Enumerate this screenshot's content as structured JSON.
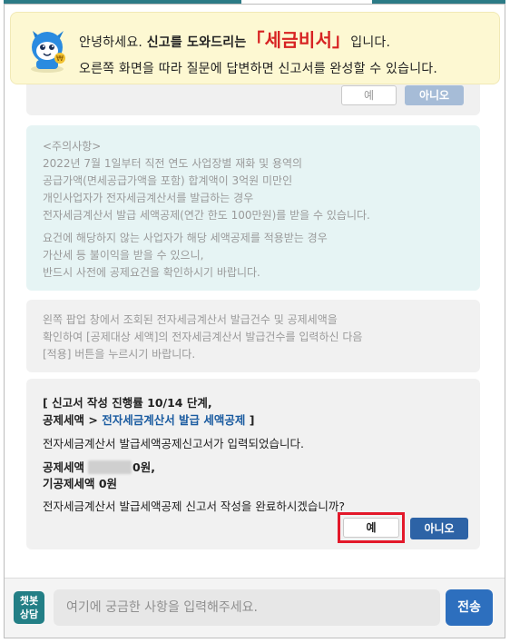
{
  "banner": {
    "greeting": "안녕하세요.",
    "intro_strong": "신고를 도와드리는",
    "bracket_open": "「",
    "brand": "세금비서",
    "bracket_close": "」",
    "suffix": "입니다.",
    "line2": "오른쪽 화면을 따라 질문에 답변하면 신고서를 완성할 수 있습니다."
  },
  "prev_card": {
    "yes_label": "예",
    "no_label": "아니오"
  },
  "notice": {
    "title": "<주의사항>",
    "lines": [
      "2022년 7월 1일부터 직전 연도 사업장별 재화 및 용역의",
      "공급가액(면세공급가액을 포함) 합계액이 3억원 미만인",
      "개인사업자가 전자세금계산서를 발급하는 경우",
      "전자세금계산서 발급 세액공제(연간 한도 100만원)를 받을 수 있습니다."
    ],
    "lines2": [
      "요건에 해당하지 않는 사업자가 해당 세액공제를 적용받는 경우",
      "가산세 등 불이익을 받을 수 있으니,",
      "반드시 사전에 공제요건을 확인하시기 바랍니다."
    ]
  },
  "guide": {
    "lines": [
      "왼쪽 팝업 창에서 조회된 전자세금계산서 발급건수 및 공제세액을",
      "확인하여 [공제대상 세액]의 전자세금계산서 발급건수를 입력하신 다음",
      "[적용] 버튼을 누르시기 바랍니다."
    ]
  },
  "main": {
    "step": "[ 신고서 작성 진행률 10/14 단계,",
    "crumb_prefix": "공제세액 > ",
    "crumb_link": "전자세금계산서 발급 세액공제",
    "crumb_suffix": " ]",
    "text1": "전자세금계산서 발급세액공제신고서가 입력되었습니다.",
    "amount1_label": "공제세액",
    "amount1_suffix": "0원,",
    "amount2": "기공제세액 0원",
    "question": "전자세금계산서 발급세액공제 신고서 작성을 완료하시겠습니까?",
    "yes_label": "예",
    "no_label": "아니오"
  },
  "input": {
    "badge_line1": "챗봇",
    "badge_line2": "상담",
    "placeholder": "여기에 궁금한 사항을 입력해주세요.",
    "send_label": "전송"
  },
  "colors": {
    "brand_red": "#d72222",
    "primary_blue": "#2d63a6",
    "teal": "#237f86",
    "highlight_red": "#e3182a"
  }
}
